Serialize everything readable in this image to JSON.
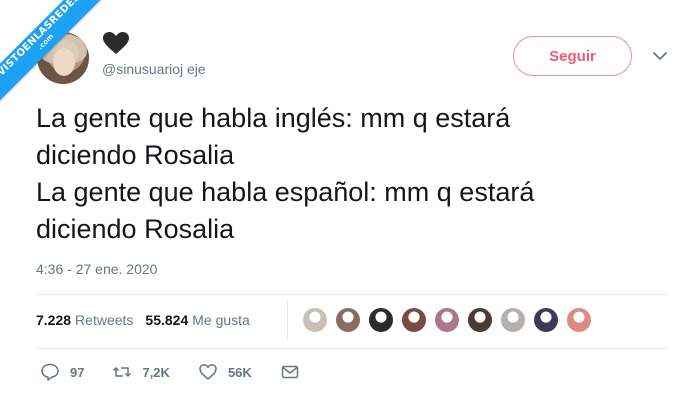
{
  "watermark": {
    "main": "VISTOENLASREDES",
    "sub": ".com"
  },
  "author": {
    "handle": "@sinusuarioj eje",
    "avatar_icon": "avatar-photo",
    "display_icon": "heart-icon"
  },
  "follow_label": "Seguir",
  "tweet": {
    "lines": [
      "La gente que habla inglés: mm q estará",
      "diciendo Rosalia",
      "La gente que habla español: mm q estará",
      "diciendo Rosalia"
    ],
    "timestamp": "4:36 - 27 ene. 2020"
  },
  "stats": {
    "retweets_count": "7.228",
    "retweets_label": "Retweets",
    "likes_count": "55.824",
    "likes_label": "Me gusta"
  },
  "liker_colors": [
    "#c9bfb8",
    "#8a6c62",
    "#2d2a2a",
    "#7b4b45",
    "#a9788c",
    "#4a3b38",
    "#b5b0ae",
    "#3d3a58",
    "#d98b84"
  ],
  "actions": {
    "reply_count": "97",
    "retweet_count": "7,2K",
    "like_count": "56K"
  },
  "colors": {
    "accent": "#1da1f2",
    "follow": "#ef5a78",
    "muted": "#657786"
  }
}
